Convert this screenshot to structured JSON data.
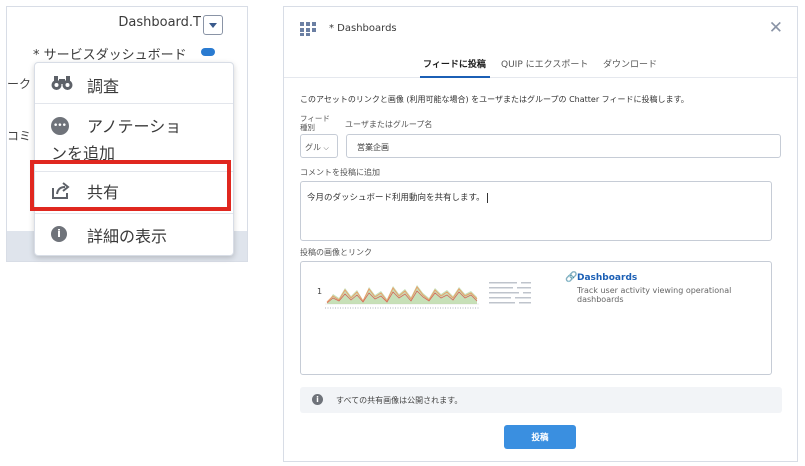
{
  "left_panel": {
    "dashboard_title": "Dashboard.T",
    "subtitle": "* サービスダッシュボード",
    "edge_fragment_1": "ーク",
    "edge_fragment_2": "コミ",
    "menu": {
      "items": [
        {
          "label": "調査",
          "icon": "binoculars-icon"
        },
        {
          "label": "アノテーションを追加",
          "icon": "annotation-icon"
        },
        {
          "label": "共有",
          "icon": "share-icon"
        },
        {
          "label": "詳細の表示",
          "icon": "info-icon"
        }
      ]
    },
    "highlight_color": "#e0271f"
  },
  "dialog": {
    "title": "* Dashboards",
    "close_icon": "close-icon",
    "tabs": [
      {
        "label": "フィードに投稿",
        "active": true
      },
      {
        "label": "QUIP にエクスポート",
        "active": false
      },
      {
        "label": "ダウンロード",
        "active": false
      }
    ],
    "description": "このアセットのリンクと画像 (利用可能な場合) をユーザまたはグループの Chatter フィードに投稿します。",
    "feed_type_label": "フィード種別",
    "user_group_label": "ユーザまたはグループ名",
    "feed_type_value": "グル",
    "user_group_value": "営業企画",
    "comment_label": "コメントを投稿に追加",
    "comment_value": "今月のダッシュボード利用動向を共有します。",
    "preview_label": "投稿の画像とリンク",
    "link_title": "Dashboards",
    "link_description": "Track user activity viewing operational dashboards",
    "note": "すべての共有画像は公開されます。",
    "post_button": "投稿",
    "accent_color": "#1b5fb5",
    "button_color": "#3a8fe0"
  }
}
